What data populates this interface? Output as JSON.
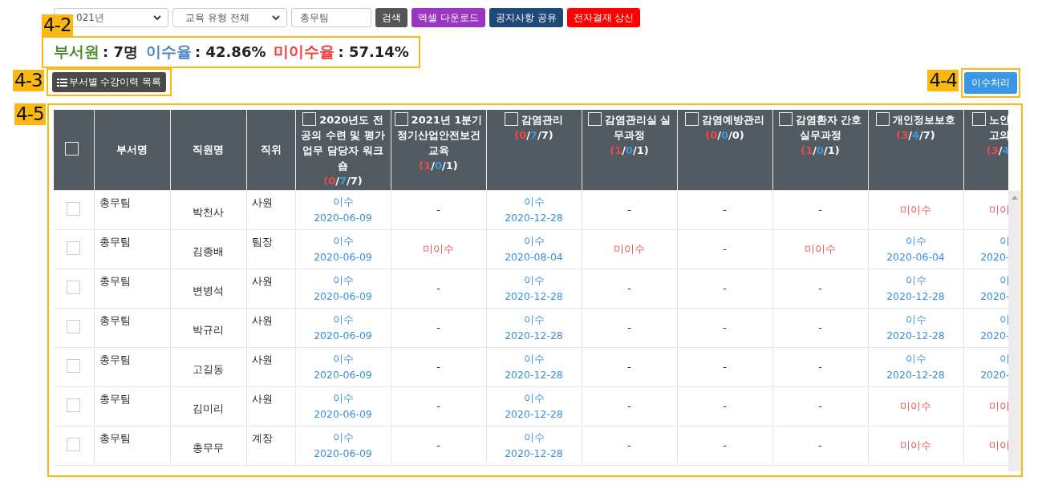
{
  "filters": {
    "year": "021년",
    "type": "교육 유형 전체",
    "department": "총무팀"
  },
  "buttons": [
    {
      "label": "검색",
      "color": "#555555"
    },
    {
      "label": "엑셀 다운로드",
      "color": "#9b36c2"
    },
    {
      "label": "공지사항 공유",
      "color": "#1f4a78"
    },
    {
      "label": "전자결재 상신",
      "color": "#ff0000"
    }
  ],
  "summary": {
    "callout": "4-2",
    "items": [
      {
        "label": "부서원",
        "value": ": 7명",
        "color": "#4f8a2b"
      },
      {
        "label": "이수율",
        "value": ": 42.86%",
        "color": "#4a88c7"
      },
      {
        "label": "미이수율",
        "value": ": 57.14%",
        "color": "#f03b3b"
      }
    ]
  },
  "list_button": {
    "callout": "4-3",
    "label": "부서별 수강이력 목록"
  },
  "complete_button": {
    "callout": "4-4",
    "label": "이수처리"
  },
  "table": {
    "callout": "4-5",
    "select_all": {
      "checked": false
    },
    "columns": [
      "부서명",
      "직원명",
      "직위"
    ],
    "courses": [
      {
        "title": "2020년도 전공의 수련 및 평가 업무 담당자 워크숍",
        "counts": "(0/7/7)",
        "checked": false
      },
      {
        "title": "2021년 1분기 정기산업안전보건교육",
        "counts": "(1/0/1)",
        "checked": false
      },
      {
        "title": "감염관리",
        "counts": "(0/7/7)",
        "checked": false
      },
      {
        "title": "감염관리실 실무과정",
        "counts": "(1/0/1)",
        "checked": false
      },
      {
        "title": "감염예방관리",
        "counts": "(0/0/0)",
        "checked": false
      },
      {
        "title": "감염환자 간호 실무과정",
        "counts": "(1/0/1)",
        "checked": false
      },
      {
        "title": "개인정보보호",
        "counts": "(3/4/7)",
        "checked": false
      },
      {
        "title": "노인 고의",
        "counts": "(3/4",
        "checked": false
      }
    ],
    "rows": [
      {
        "checked": false,
        "department": "총무팀",
        "name": "박천사",
        "position": "사원",
        "results": [
          {
            "kind": "passed",
            "status": "이수",
            "date": "2020-06-09"
          },
          {
            "kind": "none",
            "status": "-"
          },
          {
            "kind": "passed",
            "status": "이수",
            "date": "2020-12-28"
          },
          {
            "kind": "none",
            "status": "-"
          },
          {
            "kind": "none",
            "status": "-"
          },
          {
            "kind": "none",
            "status": "-"
          },
          {
            "kind": "failed",
            "status": "미이수"
          },
          {
            "kind": "failed",
            "status": "미이"
          }
        ]
      },
      {
        "checked": false,
        "department": "총무팀",
        "name": "김종배",
        "position": "팀장",
        "results": [
          {
            "kind": "passed",
            "status": "이수",
            "date": "2020-06-09"
          },
          {
            "kind": "failed",
            "status": "미이수"
          },
          {
            "kind": "passed",
            "status": "이수",
            "date": "2020-08-04"
          },
          {
            "kind": "failed",
            "status": "미이수"
          },
          {
            "kind": "none",
            "status": "-"
          },
          {
            "kind": "failed",
            "status": "미이수"
          },
          {
            "kind": "passed",
            "status": "이수",
            "date": "2020-06-04"
          },
          {
            "kind": "passed",
            "status": "이",
            "date": "2020-"
          }
        ]
      },
      {
        "checked": false,
        "department": "총무팀",
        "name": "변병석",
        "position": "사원",
        "results": [
          {
            "kind": "passed",
            "status": "이수",
            "date": "2020-06-09"
          },
          {
            "kind": "none",
            "status": "-"
          },
          {
            "kind": "passed",
            "status": "이수",
            "date": "2020-12-28"
          },
          {
            "kind": "none",
            "status": "-"
          },
          {
            "kind": "none",
            "status": "-"
          },
          {
            "kind": "none",
            "status": "-"
          },
          {
            "kind": "passed",
            "status": "이수",
            "date": "2020-12-28"
          },
          {
            "kind": "passed",
            "status": "이",
            "date": "2020-"
          }
        ]
      },
      {
        "checked": false,
        "department": "총무팀",
        "name": "박규리",
        "position": "사원",
        "results": [
          {
            "kind": "passed",
            "status": "이수",
            "date": "2020-06-09"
          },
          {
            "kind": "none",
            "status": "-"
          },
          {
            "kind": "passed",
            "status": "이수",
            "date": "2020-12-28"
          },
          {
            "kind": "none",
            "status": "-"
          },
          {
            "kind": "none",
            "status": "-"
          },
          {
            "kind": "none",
            "status": "-"
          },
          {
            "kind": "passed",
            "status": "이수",
            "date": "2020-12-28"
          },
          {
            "kind": "passed",
            "status": "이",
            "date": "2020-"
          }
        ]
      },
      {
        "checked": false,
        "department": "총무팀",
        "name": "고길동",
        "position": "사원",
        "results": [
          {
            "kind": "passed",
            "status": "이수",
            "date": "2020-06-09"
          },
          {
            "kind": "none",
            "status": "-"
          },
          {
            "kind": "passed",
            "status": "이수",
            "date": "2020-12-28"
          },
          {
            "kind": "none",
            "status": "-"
          },
          {
            "kind": "none",
            "status": "-"
          },
          {
            "kind": "none",
            "status": "-"
          },
          {
            "kind": "passed",
            "status": "이수",
            "date": "2020-12-28"
          },
          {
            "kind": "passed",
            "status": "이",
            "date": "2020-"
          }
        ]
      },
      {
        "checked": false,
        "department": "총무팀",
        "name": "김미리",
        "position": "사원",
        "results": [
          {
            "kind": "passed",
            "status": "이수",
            "date": "2020-06-09"
          },
          {
            "kind": "none",
            "status": "-"
          },
          {
            "kind": "passed",
            "status": "이수",
            "date": "2020-12-28"
          },
          {
            "kind": "none",
            "status": "-"
          },
          {
            "kind": "none",
            "status": "-"
          },
          {
            "kind": "none",
            "status": "-"
          },
          {
            "kind": "failed",
            "status": "미이수"
          },
          {
            "kind": "failed",
            "status": "미이"
          }
        ]
      },
      {
        "checked": false,
        "department": "총무팀",
        "name": "총무무",
        "position": "계장",
        "results": [
          {
            "kind": "passed",
            "status": "이수",
            "date": "2020-06-09"
          },
          {
            "kind": "none",
            "status": "-"
          },
          {
            "kind": "passed",
            "status": "이수",
            "date": "2020-12-28"
          },
          {
            "kind": "none",
            "status": "-"
          },
          {
            "kind": "none",
            "status": "-"
          },
          {
            "kind": "none",
            "status": "-"
          },
          {
            "kind": "failed",
            "status": "미이수"
          },
          {
            "kind": "failed",
            "status": "미이"
          }
        ]
      }
    ]
  }
}
